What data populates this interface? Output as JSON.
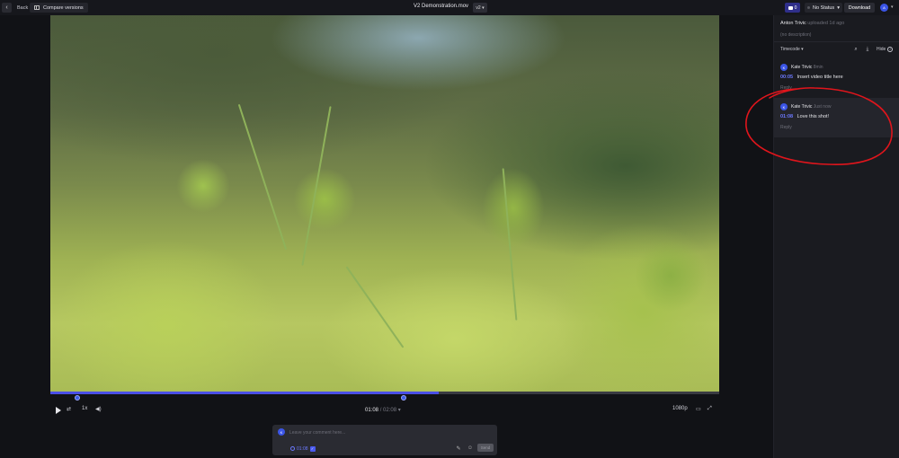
{
  "topbar": {
    "back_label": "Back",
    "compare_label": "Compare versions",
    "file_title": "V2 Demonstration.mov",
    "version": "v2",
    "comment_count": "0",
    "status_label": "No Status",
    "download_label": "Download",
    "user_initial": "A"
  },
  "player": {
    "progress": 0.58,
    "markers": [
      "00:05",
      "01:08"
    ],
    "speed": "1x",
    "current_time": "01:08",
    "duration": "02:08",
    "quality": "1080p"
  },
  "composer": {
    "avatar_initial": "K",
    "placeholder": "Leave your comment here...",
    "timecode": "01:08",
    "send_label": "Send"
  },
  "panel": {
    "uploader_name": "Anton Trivic",
    "uploaded_text": "uploaded 1d ago",
    "description": "(no description)",
    "sort_label": "Timecode",
    "hide_label": "Hide",
    "comments": [
      {
        "initial": "K",
        "author": "Kate Trivic",
        "time": "8min",
        "timecode": "00:05",
        "text": "Insert video title here",
        "reply": "Reply"
      },
      {
        "initial": "K",
        "author": "Kate Trivic",
        "time": "Just now",
        "timecode": "01:08",
        "text": "Love this shot!",
        "reply": "Reply"
      }
    ]
  },
  "colors": {
    "accent": "#4a4fe6",
    "annotation": "#e0151c"
  }
}
